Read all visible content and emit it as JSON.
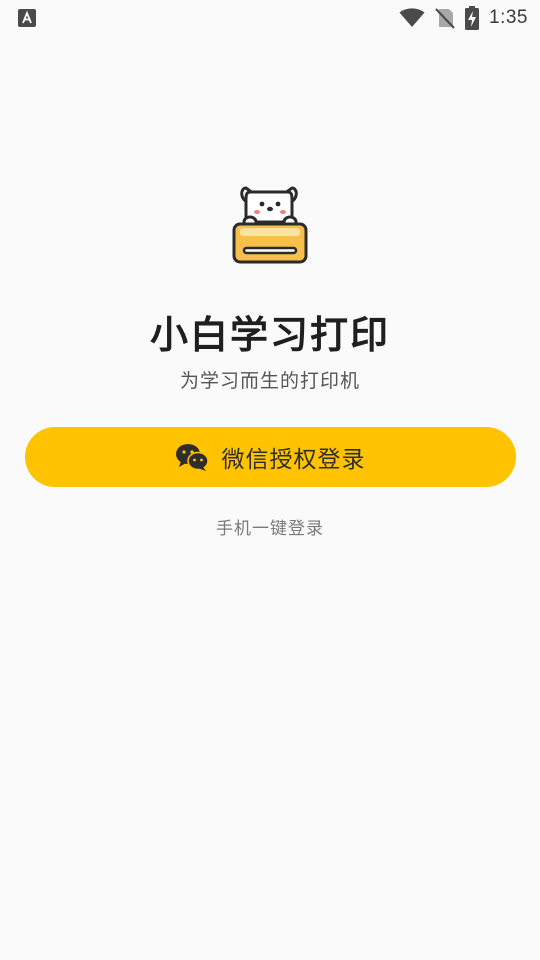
{
  "status_bar": {
    "time": "1:35",
    "icons": [
      "keyboard-a-icon",
      "wifi-icon",
      "no-signal-icon",
      "battery-charging-icon"
    ]
  },
  "app": {
    "title": "小白学习打印",
    "subtitle": "为学习而生的打印机",
    "logo": "dog-printer-logo"
  },
  "actions": {
    "wechat_login_label": "微信授权登录",
    "phone_login_label": "手机一键登录"
  },
  "colors": {
    "accent": "#ffc302",
    "background": "#fafafa",
    "title_text": "#1f1f1f",
    "muted_text": "#7a7a7a"
  }
}
